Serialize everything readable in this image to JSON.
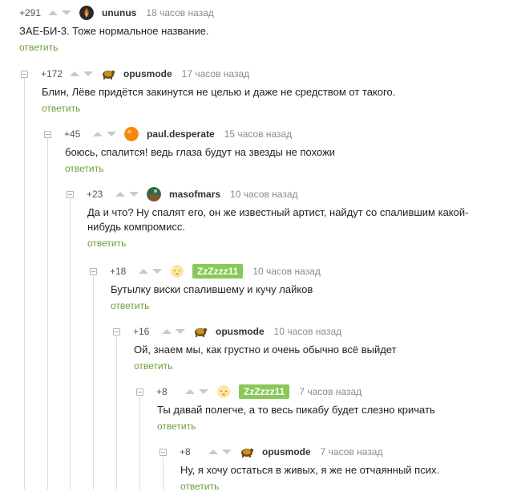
{
  "comments": [
    {
      "rating": "+291",
      "user": "ununus",
      "time": "18 часов назад",
      "text": "ЗАЕ-БИ-3. Тоже нормальное название.",
      "reply": "ответить",
      "avatar_icon": "dark-fire-avatar-icon"
    },
    {
      "rating": "+172",
      "user": "opusmode",
      "time": "17 часов назад",
      "text": "Блин, Лёве придётся закинутся не целью и даже не средством от такого.",
      "reply": "ответить",
      "avatar_icon": "turtle-avatar-icon"
    },
    {
      "rating": "+45",
      "user": "paul.desperate",
      "time": "15 часов назад",
      "text": "боюсь, спалится! ведь глаза будут на звезды не похожи",
      "reply": "ответить",
      "avatar_icon": "orange-ball-avatar-icon"
    },
    {
      "rating": "+23",
      "user": "masofmars",
      "time": "10 часов назад",
      "text": "Да и что? Ну спалят его, он же известный артист, найдут со спалившим какой-нибудь компромисс.",
      "reply": "ответить",
      "avatar_icon": "planet-avatar-icon"
    },
    {
      "rating": "+18",
      "user": "ZzZzzz11",
      "time": "10 часов назад",
      "text": "Бутылку виски спалившему и кучу лайков",
      "reply": "ответить",
      "avatar_icon": "sleepy-face-avatar-icon"
    },
    {
      "rating": "+16",
      "user": "opusmode",
      "time": "10 часов назад",
      "text": "Ой, знаем мы, как грустно и очень обычно всё выйдет",
      "reply": "ответить",
      "avatar_icon": "turtle-avatar-icon"
    },
    {
      "rating": "+8",
      "user": "ZzZzzz11",
      "time": "7 часов назад",
      "text": "Ты давай полегче, а то весь пикабу будет слезно кричать",
      "reply": "ответить",
      "avatar_icon": "sleepy-face-avatar-icon"
    },
    {
      "rating": "+8",
      "user": "opusmode",
      "time": "7 часов назад",
      "text": "Ну, я хочу остаться в живых, я же не отчаянный псих.",
      "reply": "ответить",
      "avatar_icon": "turtle-avatar-icon"
    }
  ],
  "colors": {
    "reply_link": "#6c9e3a",
    "user_badge": "#8ac858",
    "vote_arrow": "#c9c9c9"
  }
}
